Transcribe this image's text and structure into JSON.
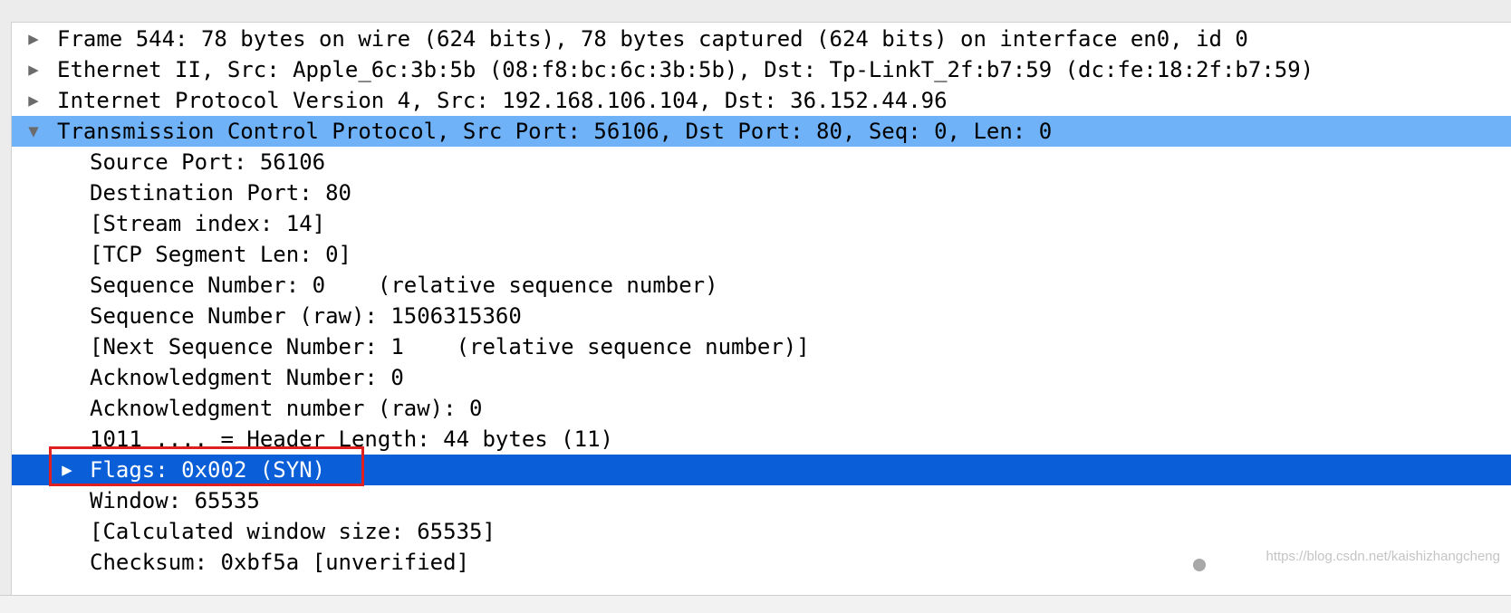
{
  "rows": [
    {
      "text": "Frame 544: 78 bytes on wire (624 bits), 78 bytes captured (624 bits) on interface en0, id 0",
      "arrow": "▶"
    },
    {
      "text": "Ethernet II, Src: Apple_6c:3b:5b (08:f8:bc:6c:3b:5b), Dst: Tp-LinkT_2f:b7:59 (dc:fe:18:2f:b7:59)",
      "arrow": "▶"
    },
    {
      "text": "Internet Protocol Version 4, Src: 192.168.106.104, Dst: 36.152.44.96",
      "arrow": "▶"
    },
    {
      "text": "Transmission Control Protocol, Src Port: 56106, Dst Port: 80, Seq: 0, Len: 0",
      "arrow": "▼"
    },
    {
      "text": "Source Port: 56106"
    },
    {
      "text": "Destination Port: 80"
    },
    {
      "text": "[Stream index: 14]"
    },
    {
      "text": "[TCP Segment Len: 0]"
    },
    {
      "text": "Sequence Number: 0    (relative sequence number)"
    },
    {
      "text": "Sequence Number (raw): 1506315360"
    },
    {
      "text": "[Next Sequence Number: 1    (relative sequence number)]"
    },
    {
      "text": "Acknowledgment Number: 0"
    },
    {
      "text": "Acknowledgment number (raw): 0"
    },
    {
      "text": "1011 .... = Header Length: 44 bytes (11)"
    },
    {
      "text": "Flags: 0x002 (SYN)",
      "arrow": "▶"
    },
    {
      "text": "Window: 65535"
    },
    {
      "text": "[Calculated window size: 65535]"
    },
    {
      "text": "Checksum: 0xbf5a [unverified]"
    }
  ],
  "watermark": "https://blog.csdn.net/kaishizhangcheng",
  "colors": {
    "expanded_row": "#6fb2f7",
    "selected_row": "#0a5fd8",
    "annotation_box": "#e02020"
  }
}
